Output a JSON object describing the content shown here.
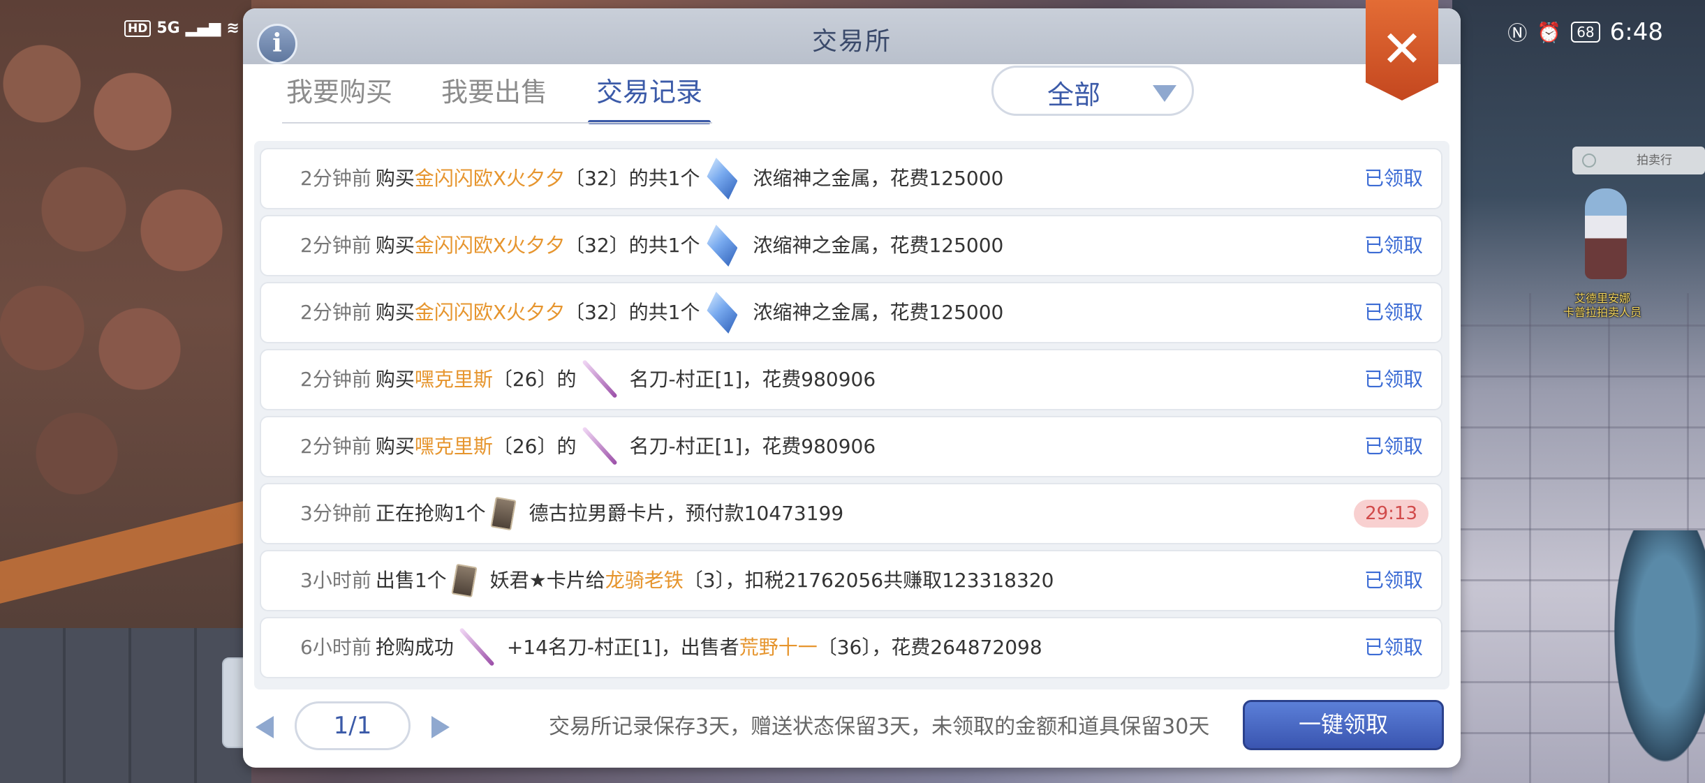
{
  "status_bar": {
    "hd": "HD",
    "signal": "5G",
    "battery": "68",
    "time": "6:48"
  },
  "dialog": {
    "title": "交易所",
    "info_icon": "i",
    "close_icon": "✕"
  },
  "tabs": [
    {
      "label": "我要购买",
      "active": false
    },
    {
      "label": "我要出售",
      "active": false
    },
    {
      "label": "交易记录",
      "active": true
    }
  ],
  "filter": {
    "label": "全部"
  },
  "records": [
    {
      "time": "2分钟前",
      "parts": [
        "购买",
        "金闪闪欧X火夕夕",
        "〔32〕的共1个",
        "浓缩神之金属，花费125000"
      ],
      "icon": "crystal",
      "status": "已领取"
    },
    {
      "time": "2分钟前",
      "parts": [
        "购买",
        "金闪闪欧X火夕夕",
        "〔32〕的共1个",
        "浓缩神之金属，花费125000"
      ],
      "icon": "crystal",
      "status": "已领取"
    },
    {
      "time": "2分钟前",
      "parts": [
        "购买",
        "金闪闪欧X火夕夕",
        "〔32〕的共1个",
        "浓缩神之金属，花费125000"
      ],
      "icon": "crystal",
      "status": "已领取"
    },
    {
      "time": "2分钟前",
      "parts": [
        "购买",
        "嘿克里斯",
        "〔26〕的",
        "名刀-村正[1]，花费980906"
      ],
      "icon": "sword",
      "status": "已领取"
    },
    {
      "time": "2分钟前",
      "parts": [
        "购买",
        "嘿克里斯",
        "〔26〕的",
        "名刀-村正[1]，花费980906"
      ],
      "icon": "sword",
      "status": "已领取"
    },
    {
      "time": "3分钟前",
      "parts": [
        "正在抢购1个",
        "",
        "",
        "德古拉男爵卡片，预付款10473199"
      ],
      "icon": "card",
      "timer": "29:13"
    },
    {
      "time": "3小时前",
      "parts": [
        "出售1个",
        "",
        "",
        "妖君★卡片给",
        "龙骑老铁",
        "〔3〕，扣税21762056共赚取123318320"
      ],
      "icon": "card",
      "status": "已领取"
    },
    {
      "time": "6小时前",
      "parts": [
        "抢购成功",
        "",
        "",
        "+14名刀-村正[1]，出售者",
        "荒野十一",
        "〔36〕，花费264872098"
      ],
      "icon": "sword",
      "status": "已领取"
    }
  ],
  "pager": {
    "page": "1/1"
  },
  "footer": {
    "note": "交易所记录保存3天，赠送状态保留3天，未领取的金额和道具保留30天",
    "collect_all": "一键领取"
  },
  "scene": {
    "npc_tag": "拍卖行",
    "npc_name_1": "艾德里安娜",
    "npc_name_2": "卡普拉拍卖人员"
  },
  "colors": {
    "accent": "#3b5aa8",
    "highlight": "#e6952e",
    "status_collected": "#3b6bd4",
    "timer": "#d14a4a"
  }
}
